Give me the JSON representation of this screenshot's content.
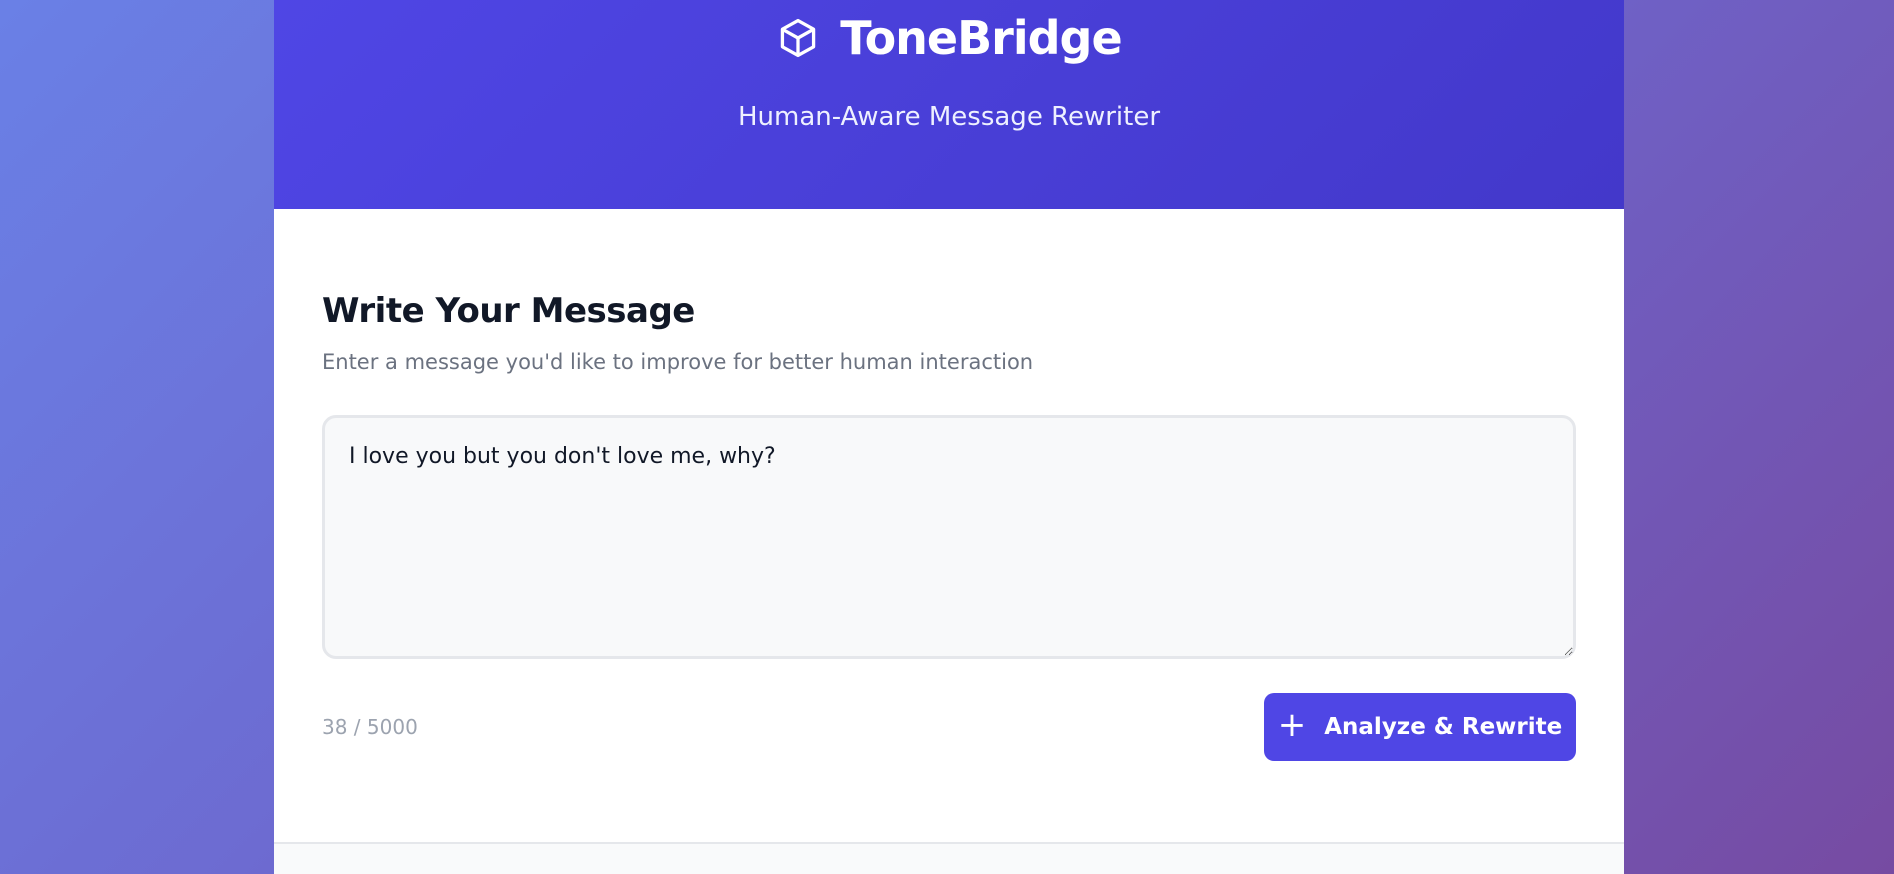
{
  "header": {
    "brand_icon": "cube-icon",
    "title": "ToneBridge",
    "tagline": "Human-Aware Message Rewriter"
  },
  "composer": {
    "heading": "Write Your Message",
    "description": "Enter a message you'd like to improve for better human interaction",
    "message_value": "I love you but you don't love me, why?",
    "char_count": "38 / 5000",
    "submit_label": "Analyze & Rewrite",
    "submit_icon": "plus-icon"
  },
  "colors": {
    "accent": "#4f46e5",
    "header_gradient_start": "#4f46e5",
    "header_gradient_end": "#4338ca",
    "page_gradient_start": "#6a80e6",
    "page_gradient_end": "#764ba2"
  }
}
